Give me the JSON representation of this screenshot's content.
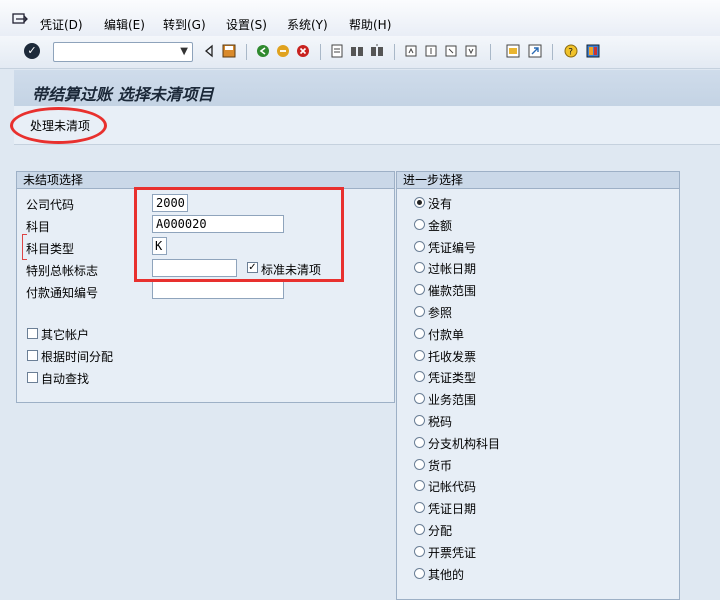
{
  "menu": {
    "items": [
      "凭证(D)",
      "编辑(E)",
      "转到(G)",
      "设置(S)",
      "系统(Y)",
      "帮助(H)"
    ]
  },
  "toolbar": {
    "command_value": ""
  },
  "page": {
    "title": "带结算过账 选择未清项目"
  },
  "appbar": {
    "process_button": "处理未清项"
  },
  "open_items": {
    "heading": "未结项选择",
    "company_code_label": "公司代码",
    "company_code_value": "2000",
    "account_label": "科目",
    "account_value": "A000020",
    "account_type_label": "科目类型",
    "account_type_value": "K",
    "special_gl_label": "特别总帐标志",
    "special_gl_value": "",
    "standard_oi_label": "标准未清项",
    "payment_advice_label": "付款通知编号",
    "payment_advice_value": "",
    "other_accounts_label": "其它帐户",
    "distribute_by_age_label": "根据时间分配",
    "auto_search_label": "自动查找"
  },
  "further_selection": {
    "heading": "进一步选择",
    "options": [
      "没有",
      "金额",
      "凭证编号",
      "过帐日期",
      "催款范围",
      "参照",
      "付款单",
      "托收发票",
      "凭证类型",
      "业务范围",
      "税码",
      "分支机构科目",
      "货币",
      "记帐代码",
      "凭证日期",
      "分配",
      "开票凭证",
      "其他的"
    ],
    "selected": 0
  },
  "colors": {
    "highlight": "#e8302e",
    "header_bg": "#cad8e8"
  }
}
